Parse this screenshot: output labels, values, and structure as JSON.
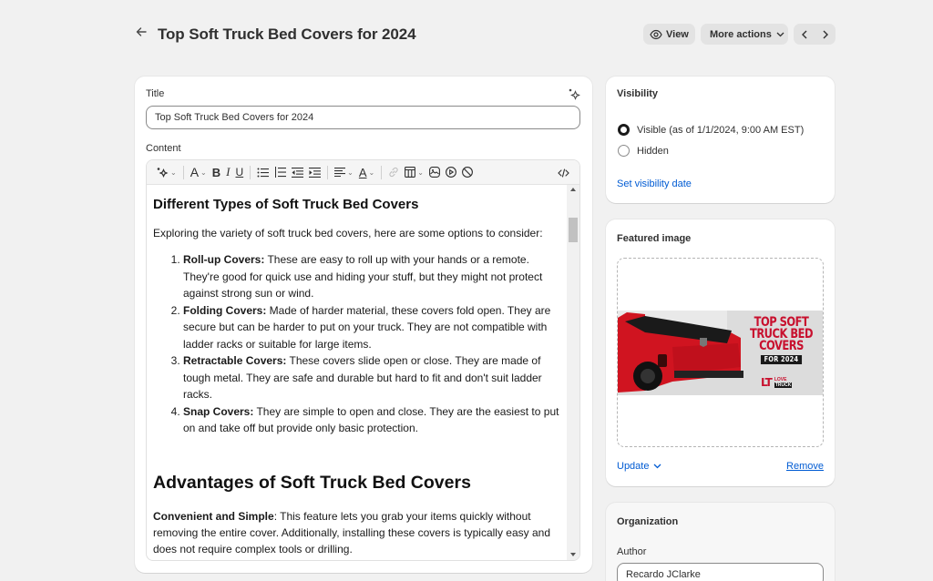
{
  "header": {
    "back_icon": "arrow-left-icon",
    "title": "Top Soft Truck Bed Covers for 2024",
    "view_label": "View",
    "more_actions_label": "More actions",
    "prev_icon": "chevron-left-icon",
    "next_icon": "chevron-right-icon"
  },
  "editor": {
    "title_label": "Title",
    "title_value": "Top Soft Truck Bed Covers for 2024",
    "ai_icon": "sparkle-icon",
    "content_label": "Content",
    "toolbar": [
      {
        "name": "ai-generate",
        "icon": "sparkle-icon",
        "dropdown": true
      },
      {
        "name": "text-style",
        "icon": "font-a-icon",
        "dropdown": true
      },
      {
        "name": "bold",
        "icon": "bold-icon"
      },
      {
        "name": "italic",
        "icon": "italic-icon"
      },
      {
        "name": "underline",
        "icon": "underline-icon"
      },
      {
        "name": "bulleted-list",
        "icon": "bulleted-list-icon"
      },
      {
        "name": "numbered-list",
        "icon": "numbered-list-icon"
      },
      {
        "name": "outdent",
        "icon": "outdent-icon"
      },
      {
        "name": "indent",
        "icon": "indent-icon"
      },
      {
        "name": "align",
        "icon": "align-left-icon",
        "dropdown": true
      },
      {
        "name": "text-color",
        "icon": "text-color-icon",
        "dropdown": true
      },
      {
        "name": "link",
        "icon": "link-icon",
        "disabled": true
      },
      {
        "name": "table",
        "icon": "table-icon",
        "dropdown": true
      },
      {
        "name": "image",
        "icon": "image-icon"
      },
      {
        "name": "video",
        "icon": "play-circle-icon"
      },
      {
        "name": "clear-formatting",
        "icon": "block-icon"
      },
      {
        "name": "html-source",
        "icon": "code-icon"
      }
    ],
    "content": {
      "heading1": "Different Types of Soft Truck Bed Covers",
      "intro": "Exploring the variety of soft truck bed covers, here are some options to consider:",
      "list": [
        {
          "term": "Roll-up Covers:",
          "text": " These are easy to roll up with your hands or a remote. They're good for quick use and hiding your stuff, but they might not protect against strong sun or wind."
        },
        {
          "term": "Folding Covers:",
          "text": " Made of harder material, these covers fold open. They are secure but can be harder to put on your truck. They are not compatible with ladder racks or suitable for large items."
        },
        {
          "term": "Retractable Covers:",
          "text": " These covers slide open or close. They are made of tough metal. They are safe and durable but hard to fit and don't suit ladder racks."
        },
        {
          "term": "Snap Covers:",
          "text": " They are simple to open and close. They are the easiest to put on and take off but provide only basic protection."
        }
      ],
      "heading2": "Advantages of Soft Truck Bed Covers",
      "para_term": "Convenient and Simple",
      "para_text": ": This feature lets you grab your items quickly without removing the entire cover. Additionally, installing these covers is typically easy and does not require complex tools or drilling."
    }
  },
  "visibility": {
    "title": "Visibility",
    "options": [
      {
        "label": "Visible (as of 1/1/2024, 9:00 AM EST)",
        "checked": true
      },
      {
        "label": "Hidden",
        "checked": false
      }
    ],
    "set_date_link": "Set visibility date"
  },
  "featured_image": {
    "title": "Featured image",
    "image_text_line1": "TOP SOFT",
    "image_text_line2": "TRUCK BED",
    "image_text_line3": "COVERS",
    "image_text_for": "FOR 2024",
    "image_brand_logo": "LT",
    "image_brand_top": "LOVE",
    "image_brand_bottom": "TRUCK",
    "update_label": "Update",
    "remove_label": "Remove"
  },
  "organization": {
    "title": "Organization",
    "author_label": "Author",
    "author_value": "Recardo JClarke"
  },
  "colors": {
    "background": "#f1f1f1",
    "link": "#005bd3",
    "image_accent": "#c8102e"
  }
}
